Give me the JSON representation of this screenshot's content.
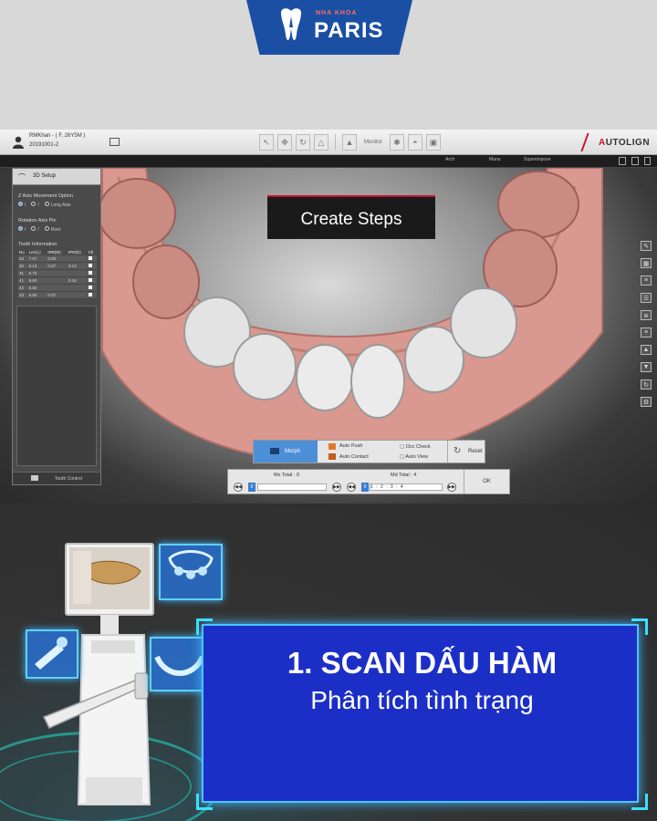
{
  "brand": {
    "tagline": "NHA KHOA",
    "name": "PARIS"
  },
  "app": {
    "patient_name": "RMKhan - ( F, 26Y5M )",
    "patient_id": "20191001-2",
    "monitor_label": "Monitor",
    "logo_letter": "A",
    "logo_rest": "UTOLIGN",
    "secondbar": {
      "arch": "Arch",
      "manu": "Manu",
      "superimpose": "Superimpose"
    },
    "create_steps": "Create Steps",
    "panel": {
      "title": "3D Setup",
      "z_axis_label": "Z Axis Movement Option",
      "z_opt_long": "Long Axis",
      "rotation_label": "Rotation Axis Pin",
      "rot_opt_root": "Root",
      "tooth_info_label": "Tooth Information",
      "table_headers": [
        "No",
        "Len(L)",
        "IRR(M)",
        "IPR(D)",
        "Ctl"
      ],
      "rows": [
        [
          "33",
          "7.07",
          "0.00",
          "",
          ""
        ],
        [
          "32",
          "6.13",
          "0.07",
          "0.13",
          ""
        ],
        [
          "31",
          "5.72",
          "",
          "",
          ""
        ],
        [
          "41",
          "5.60",
          "",
          "0.14",
          ""
        ],
        [
          "42",
          "5.50",
          "",
          "",
          ""
        ],
        [
          "43",
          "6.60",
          "0.07",
          "",
          ""
        ]
      ],
      "footer_label": "Tooth Control"
    },
    "controls": {
      "morph": "Morph",
      "auto_push": "Auto Push",
      "auto_contact": "Auto Contact",
      "occ_check": "Occ Check",
      "auto_view": "Auto View",
      "reset": "Reset"
    },
    "steps": {
      "mx_total": "Mx Total : 0",
      "md_total": "Md Total : 4",
      "mx_current": "0",
      "md_current": "0",
      "md_sequence": "1 : 2 : 3 : 4",
      "ok": "OK"
    }
  },
  "promo": {
    "title": "1. SCAN DẤU HÀM",
    "subtitle": "Phân tích tình trạng"
  },
  "colors": {
    "brand_blue": "#1a4fa3",
    "accent_red": "#c8102e",
    "promo_blue": "#1b2fc7",
    "glow_cyan": "#4cc5ff"
  }
}
